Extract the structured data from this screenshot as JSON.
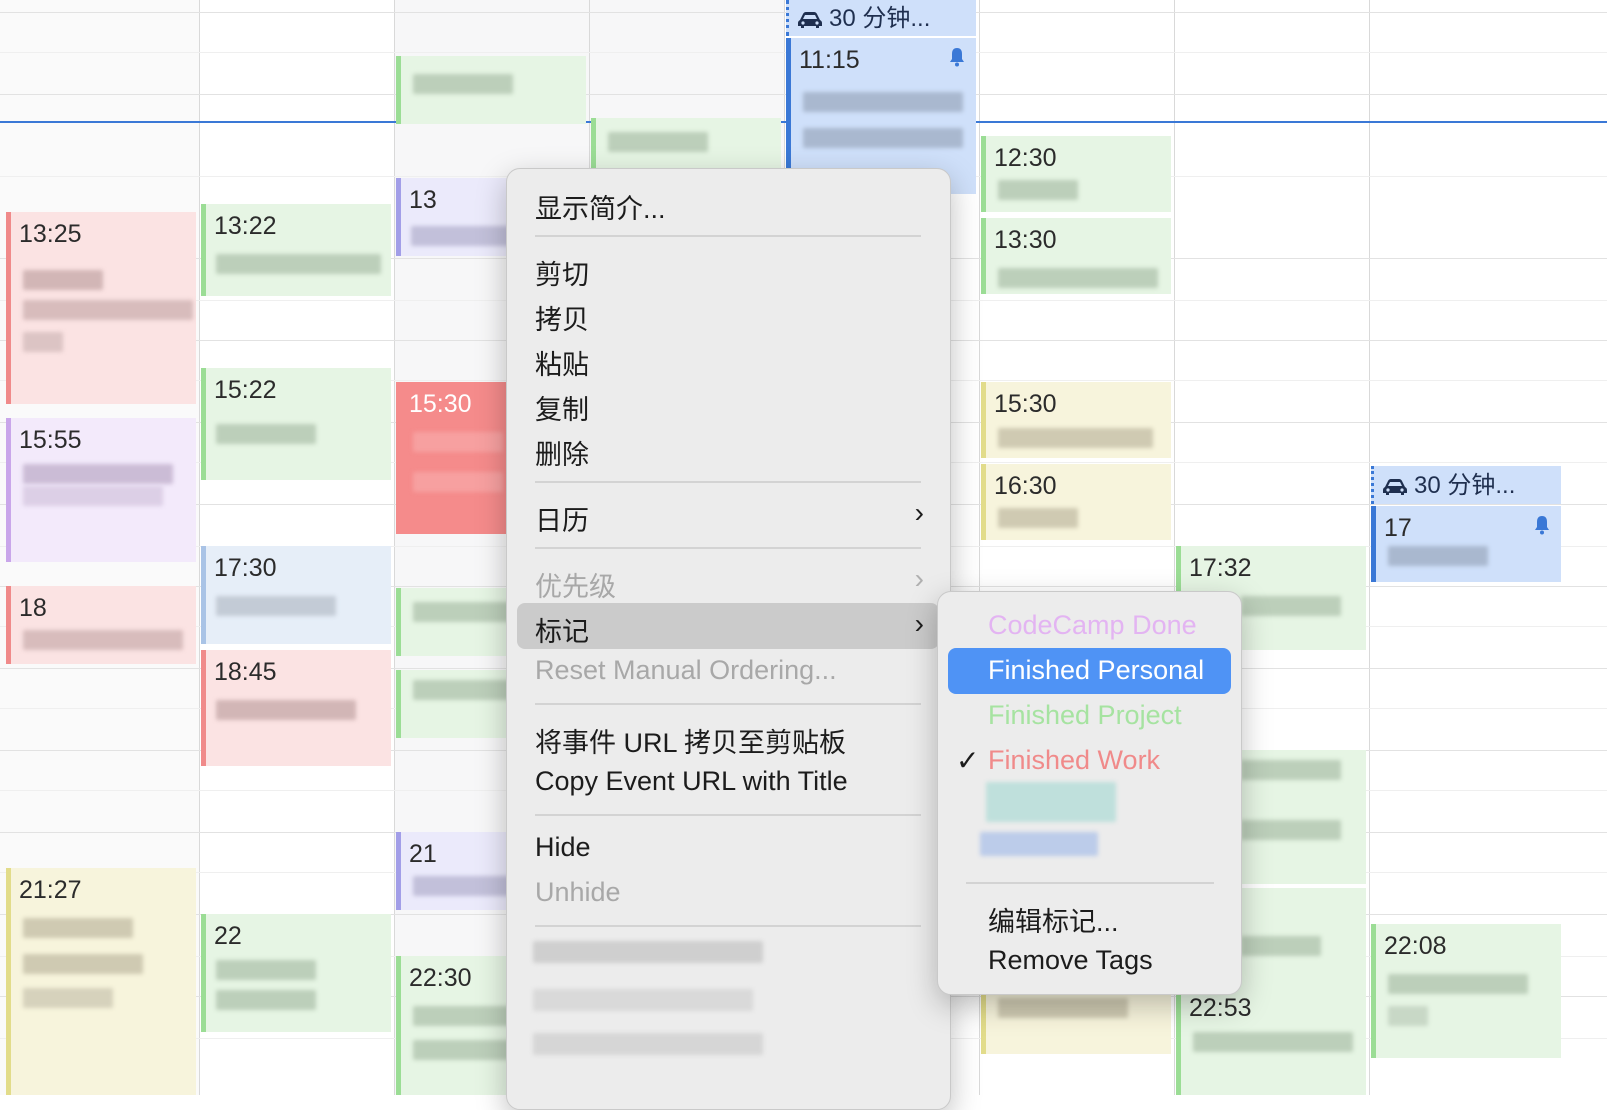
{
  "colors": {
    "accent": "#3a78d6",
    "green": "#9bdd95",
    "red": "#f08080",
    "purple": "#a29ee8",
    "yellow": "#e2dc8a",
    "blue": "#4f93f5"
  },
  "events": [
    {
      "time": "13:25"
    },
    {
      "time": "13:22"
    },
    {
      "time": "13"
    },
    {
      "time": "11:15"
    },
    {
      "time": "12:30"
    },
    {
      "time": "13:30"
    },
    {
      "time": "15:55"
    },
    {
      "time": "15:22"
    },
    {
      "time": "15:30"
    },
    {
      "time": "15:30"
    },
    {
      "time": "16:30"
    },
    {
      "time": "17"
    },
    {
      "time": "17:30"
    },
    {
      "time": "17:32"
    },
    {
      "time": "18"
    },
    {
      "time": "18:45"
    },
    {
      "time": "21"
    },
    {
      "time": "21:27"
    },
    {
      "time": "22"
    },
    {
      "time": "22:30"
    },
    {
      "time": "22:08"
    },
    {
      "time": "22:53"
    }
  ],
  "travel": [
    {
      "label": "30 分钟..."
    },
    {
      "label": "30 分钟..."
    }
  ],
  "context_menu": {
    "show_info": "显示简介...",
    "cut": "剪切",
    "copy": "拷贝",
    "paste": "粘贴",
    "duplicate": "复制",
    "delete": "删除",
    "calendar": "日历",
    "priority": "优先级",
    "tags": "标记",
    "reset_ordering": "Reset Manual Ordering...",
    "copy_url": "将事件 URL 拷贝至剪贴板",
    "copy_url_title": "Copy Event URL with Title",
    "hide": "Hide",
    "unhide": "Unhide"
  },
  "tags_submenu": {
    "items": [
      {
        "label": "CodeCamp Done",
        "color": "#e3b4f2"
      },
      {
        "label": "Finished Personal",
        "color": "#ffffff",
        "selected": true
      },
      {
        "label": "Finished Project",
        "color": "#a6e3a1"
      },
      {
        "label": "Finished Work",
        "color": "#f08a8a",
        "checked": true
      }
    ],
    "edit_tags": "编辑标记...",
    "remove_tags": "Remove Tags"
  }
}
